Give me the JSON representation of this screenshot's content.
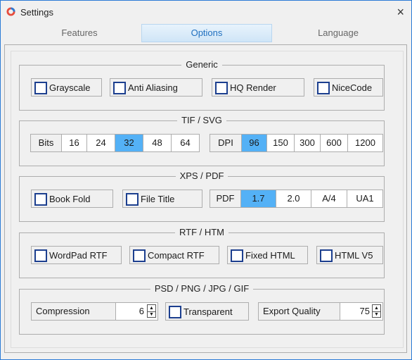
{
  "window": {
    "title": "Settings",
    "close_glyph": "×"
  },
  "tabs": [
    {
      "label": "Features",
      "active": false
    },
    {
      "label": "Options",
      "active": true
    },
    {
      "label": "Language",
      "active": false
    }
  ],
  "generic": {
    "legend": "Generic",
    "checkboxes": [
      "Grayscale",
      "Anti Aliasing",
      "HQ Render",
      "NiceCode"
    ]
  },
  "tif_svg": {
    "legend": "TIF / SVG",
    "bits_label": "Bits",
    "bits": [
      "16",
      "24",
      "32",
      "48",
      "64"
    ],
    "bits_selected": "32",
    "dpi_label": "DPI",
    "dpi": [
      "96",
      "150",
      "300",
      "600",
      "1200"
    ],
    "dpi_selected": "96"
  },
  "xps_pdf": {
    "legend": "XPS / PDF",
    "checkboxes": [
      "Book Fold",
      "File Title"
    ],
    "pdf_label": "PDF",
    "pdf_versions": [
      "1.7",
      "2.0",
      "A/4",
      "UA1"
    ],
    "pdf_selected": "1.7"
  },
  "rtf_htm": {
    "legend": "RTF / HTM",
    "checkboxes": [
      "WordPad RTF",
      "Compact RTF",
      "Fixed HTML",
      "HTML V5"
    ]
  },
  "psd_png": {
    "legend": "PSD / PNG / JPG / GIF",
    "compression_label": "Compression",
    "compression_value": "6",
    "transparent_label": "Transparent",
    "export_quality_label": "Export Quality",
    "export_quality_value": "75"
  },
  "colors": {
    "accent": "#54b1f6",
    "checkbox_border": "#1c3f8f",
    "window_border": "#2b7bd6"
  },
  "icons": {
    "app": "app-ring-icon",
    "close": "close-icon",
    "spin_up": "spin-up-icon",
    "spin_down": "spin-down-icon"
  }
}
